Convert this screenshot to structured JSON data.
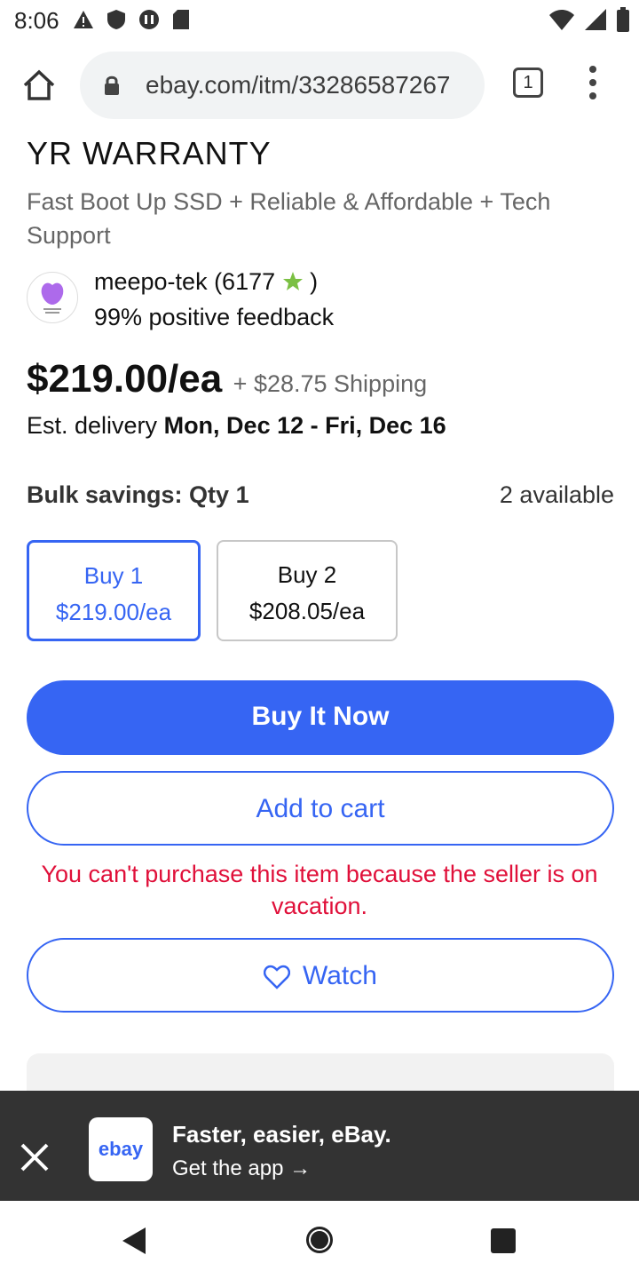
{
  "status_bar": {
    "time": "8:06"
  },
  "browser": {
    "url": "ebay.com/itm/33286587267",
    "tab_count": "1"
  },
  "listing": {
    "title_fragment": "YR WARRANTY",
    "subtitle": "Fast Boot Up SSD + Reliable & Affordable + Tech Support",
    "seller_name": "meepo-tek (6177",
    "seller_name_close": ")",
    "seller_feedback": "99% positive feedback",
    "price": "$219.00/ea",
    "shipping": "+ $28.75 Shipping",
    "delivery_prefix": "Est. delivery",
    "delivery_dates": "Mon, Dec 12 - Fri, Dec 16",
    "bulk_label": "Bulk savings: Qty 1",
    "available": "2 available",
    "tiers": [
      {
        "qty": "Buy 1",
        "price": "$219.00/ea"
      },
      {
        "qty": "Buy 2",
        "price": "$208.05/ea"
      }
    ],
    "buy_now_label": "Buy It Now",
    "add_to_cart_label": "Add to cart",
    "vacation_notice": "You can't purchase this item because the seller is on vacation.",
    "watch_label": "Watch"
  },
  "app_banner": {
    "logo_text": "ebay",
    "headline": "Faster, easier, eBay.",
    "cta": "Get the app →"
  },
  "colors": {
    "accent": "#3665f3",
    "error": "#e0103a",
    "banner_bg": "#333333"
  }
}
